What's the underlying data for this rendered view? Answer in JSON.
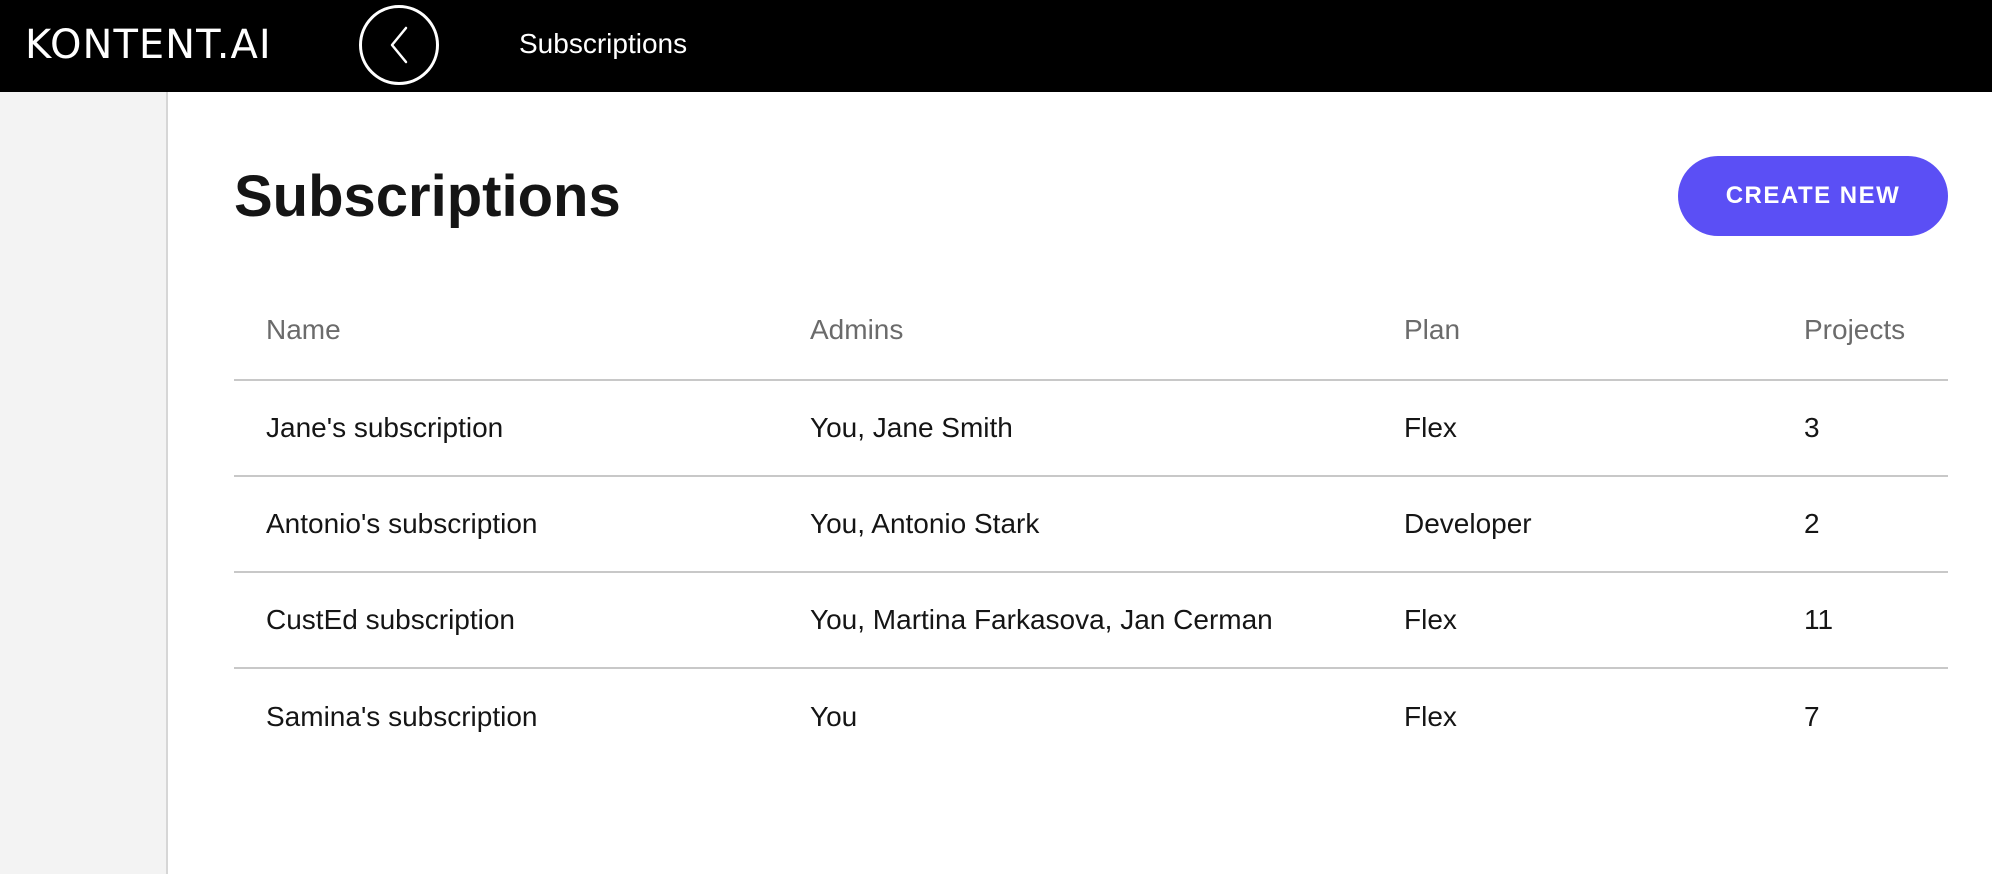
{
  "topbar": {
    "logo_text": "KONTENT.AI",
    "back_icon": "chevron-left-icon",
    "title": "Subscriptions"
  },
  "page": {
    "title": "Subscriptions",
    "create_button_label": "CREATE NEW"
  },
  "colors": {
    "topbar_bg": "#000000",
    "accent": "#5b4ff5",
    "sidebar_bg": "#f3f3f3",
    "header_text": "#6b6b6b",
    "divider": "#c8c8c8"
  },
  "table": {
    "columns": [
      "Name",
      "Admins",
      "Plan",
      "Projects"
    ],
    "rows": [
      {
        "name": "Jane's subscription",
        "admins": "You, Jane Smith",
        "plan": "Flex",
        "projects": "3"
      },
      {
        "name": "Antonio's subscription",
        "admins": "You, Antonio Stark",
        "plan": "Developer",
        "projects": "2"
      },
      {
        "name": "CustEd subscription",
        "admins": "You, Martina Farkasova, Jan Cerman",
        "plan": "Flex",
        "projects": "11"
      },
      {
        "name": "Samina's subscription",
        "admins": "You",
        "plan": "Flex",
        "projects": "7"
      }
    ]
  }
}
